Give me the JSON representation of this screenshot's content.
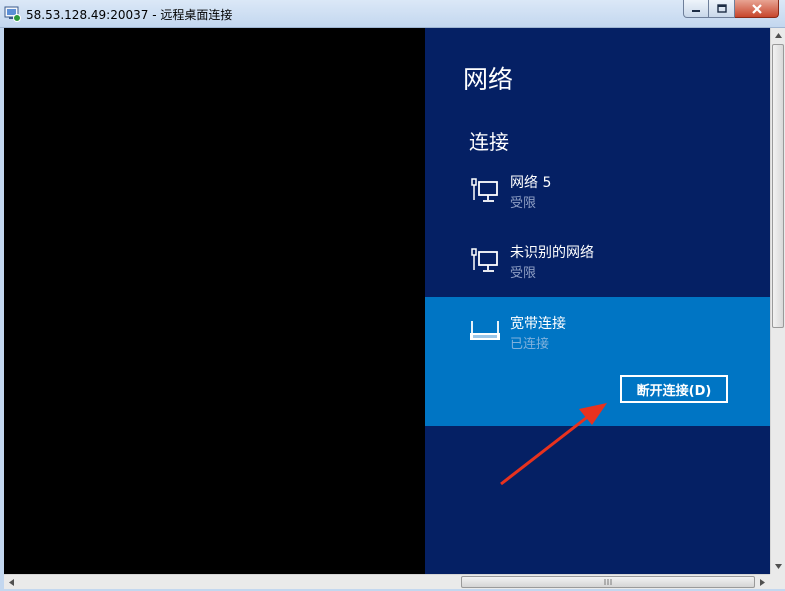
{
  "window": {
    "title": "58.53.128.49:20037 - 远程桌面连接",
    "controls": [
      "minimize-icon",
      "maximize-icon",
      "close-icon"
    ]
  },
  "charm": {
    "title": "网络",
    "section_title": "连接",
    "networks": [
      {
        "name": "网络  5",
        "status": "受限",
        "icon": "wired-network-icon"
      },
      {
        "name": "未识别的网络",
        "status": "受限",
        "icon": "wired-network-icon"
      },
      {
        "name": "宽带连接",
        "status": "已连接",
        "icon": "broadband-icon",
        "selected": true
      }
    ],
    "disconnect_button": "断开连接(D)"
  },
  "colors": {
    "charm_bg": "#052064",
    "selected_bg": "#0075c4",
    "remote_bg": "#000000",
    "annotation_arrow": "#e8321e"
  }
}
